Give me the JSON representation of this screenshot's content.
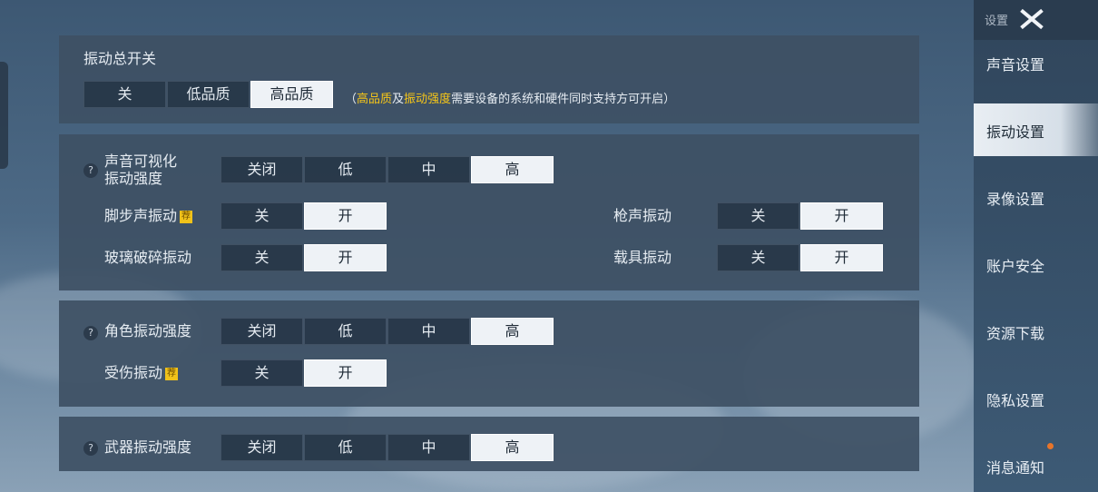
{
  "sidebar": {
    "title": "设置",
    "items": [
      {
        "label": "声音设置"
      },
      {
        "label": "振动设置"
      },
      {
        "label": "录像设置"
      },
      {
        "label": "账户安全"
      },
      {
        "label": "资源下载"
      },
      {
        "label": "隐私设置"
      },
      {
        "label": "消息通知"
      }
    ],
    "active_index": 1
  },
  "master": {
    "title": "振动总开关",
    "options": [
      "关",
      "低品质",
      "高品质"
    ],
    "selected": "高品质",
    "hint": {
      "open": "（",
      "hl1": "高品质",
      "mid": "及",
      "hl2": "振动强度",
      "rest": "需要设备的系统和硬件同时支持方可开启）"
    }
  },
  "sound_visual": {
    "title_line1": "声音可视化",
    "title_line2": "振动强度",
    "options": [
      "关闭",
      "低",
      "中",
      "高"
    ],
    "selected": "高",
    "footstep": {
      "label": "脚步声振动",
      "tag": "荐",
      "options": [
        "关",
        "开"
      ],
      "selected": "开"
    },
    "glass": {
      "label": "玻璃破碎振动",
      "options": [
        "关",
        "开"
      ],
      "selected": "开"
    },
    "gunshot": {
      "label": "枪声振动",
      "options": [
        "关",
        "开"
      ],
      "selected": "开"
    },
    "vehicle": {
      "label": "载具振动",
      "options": [
        "关",
        "开"
      ],
      "selected": "开"
    }
  },
  "character": {
    "title": "角色振动强度",
    "options": [
      "关闭",
      "低",
      "中",
      "高"
    ],
    "selected": "高",
    "injury": {
      "label": "受伤振动",
      "tag": "荐",
      "options": [
        "关",
        "开"
      ],
      "selected": "开"
    }
  },
  "weapon": {
    "title": "武器振动强度",
    "options": [
      "关闭",
      "低",
      "中",
      "高"
    ],
    "selected": "高"
  },
  "help_glyph": "?",
  "colors": {
    "highlight": "#f5c518",
    "badge": "#f0c21a",
    "notify_dot": "#e8752a"
  }
}
